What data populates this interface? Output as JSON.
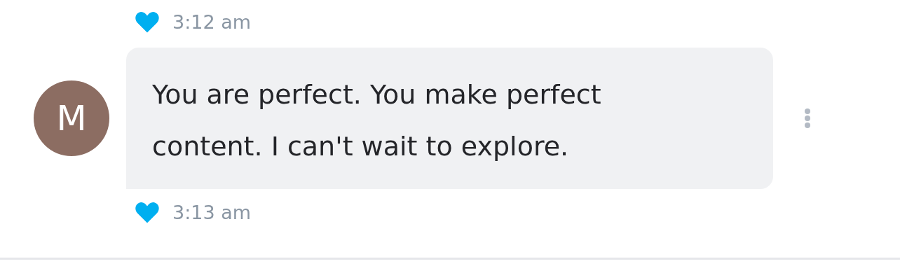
{
  "previous_message": {
    "liked": true,
    "time": "3:12 am"
  },
  "message": {
    "avatar_initial": "M",
    "text": "You are perfect. You make perfect content. I can't wait to explore.",
    "liked": true,
    "time": "3:13 am"
  }
}
